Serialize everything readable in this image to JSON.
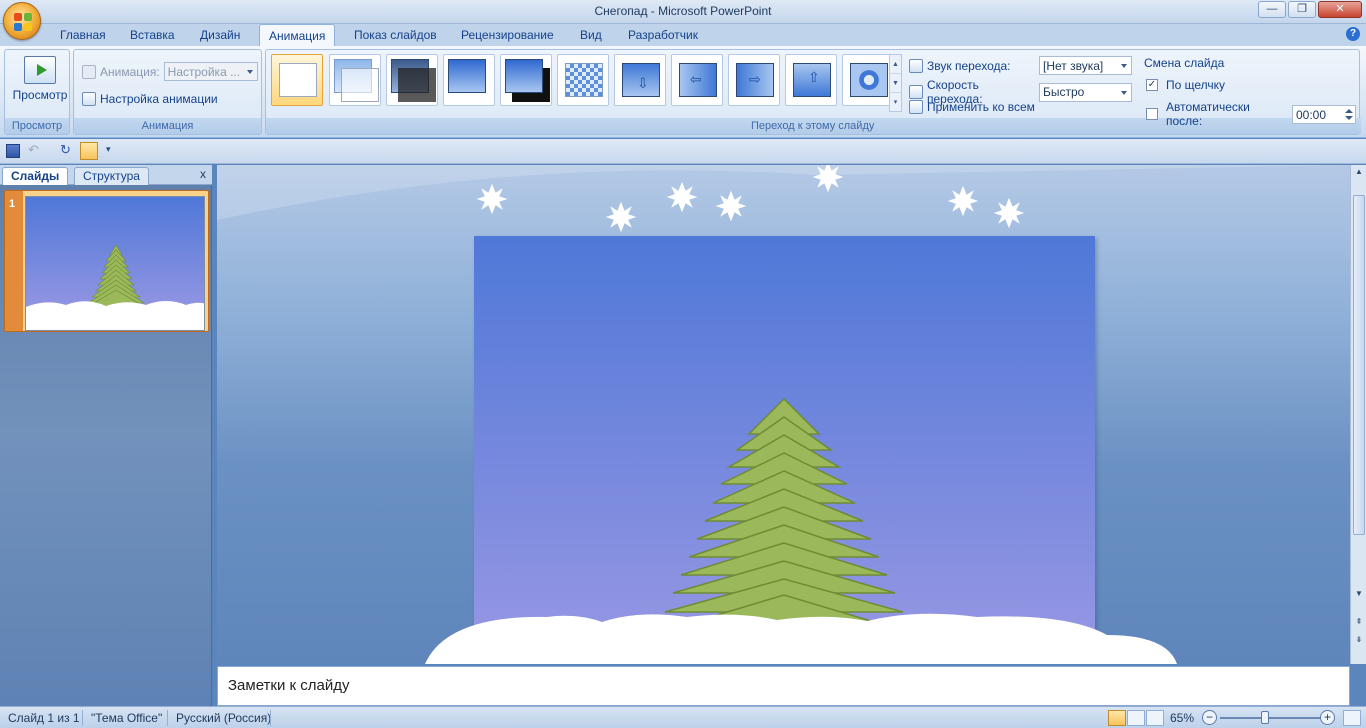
{
  "window": {
    "title": "Снегопад - Microsoft PowerPoint",
    "controls": {
      "minimize": "—",
      "maximize": "❐",
      "close": "✕"
    }
  },
  "tabs": [
    {
      "label": "Главная"
    },
    {
      "label": "Вставка"
    },
    {
      "label": "Дизайн"
    },
    {
      "label": "Анимация",
      "active": true
    },
    {
      "label": "Показ слайдов"
    },
    {
      "label": "Рецензирование"
    },
    {
      "label": "Вид"
    },
    {
      "label": "Разработчик"
    }
  ],
  "ribbon": {
    "preview": {
      "button_label": "Просмотр",
      "group_label": "Просмотр"
    },
    "animation": {
      "animation_label": "Анимация:",
      "animation_value": "Настройка ...",
      "custom_label": "Настройка анимации",
      "group_label": "Анимация"
    },
    "transitions": {
      "group_label": "Переход к этому слайду",
      "sound_label": "Звук перехода:",
      "sound_value": "[Нет звука]",
      "speed_label": "Скорость перехода:",
      "speed_value": "Быстро",
      "apply_all_label": "Применить ко всем"
    },
    "advance": {
      "title": "Смена слайда",
      "on_click_label": "По щелчку",
      "on_click_checked": true,
      "after_label": "Автоматически после:",
      "after_checked": false,
      "after_value": "00:00"
    }
  },
  "slides_panel": {
    "tab_slides": "Слайды",
    "tab_outline": "Структура",
    "close": "x",
    "slide_number": "1"
  },
  "notes": {
    "placeholder": "Заметки к слайду"
  },
  "status": {
    "slide": "Слайд 1 из 1",
    "theme": "\"Тема Office\"",
    "language": "Русский (Россия)",
    "zoom": "65%",
    "zoom_fraction": 0.45
  },
  "colors": {
    "slide_top": "#4f78d8",
    "slide_bottom": "#a09be4",
    "tree_fill": "#9bb85a",
    "tree_stroke": "#6f8c32",
    "snow": "#ffffff"
  },
  "icons": {
    "office_button": "office-logo-icon",
    "help": "help-icon",
    "save": "save-icon",
    "undo": "undo-icon",
    "redo": "redo-icon"
  }
}
